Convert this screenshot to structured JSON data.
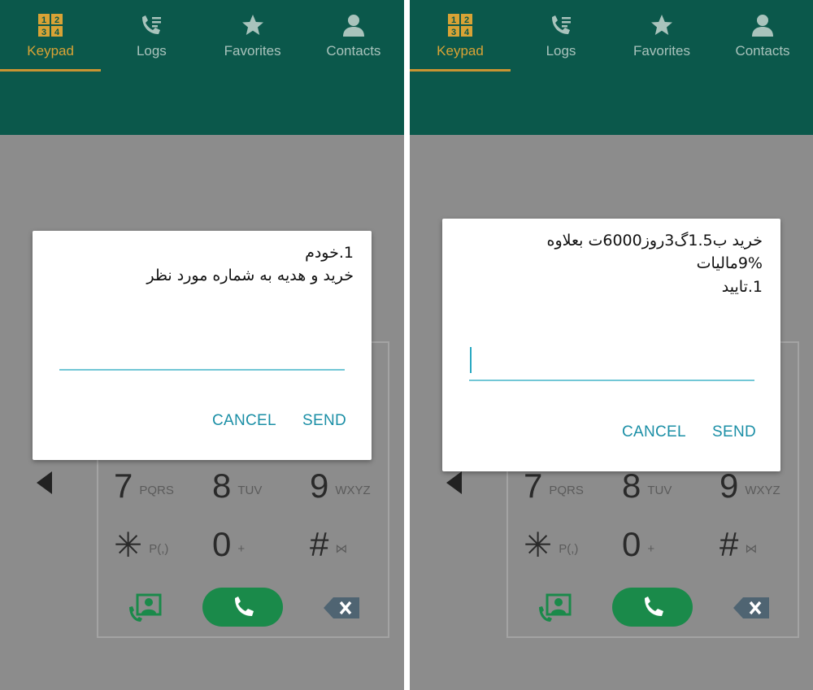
{
  "tabs": [
    {
      "label": "Keypad",
      "icon": "keypad-icon"
    },
    {
      "label": "Logs",
      "icon": "call-logs-icon"
    },
    {
      "label": "Favorites",
      "icon": "star-icon"
    },
    {
      "label": "Contacts",
      "icon": "person-icon"
    }
  ],
  "keypad_icon_digits": [
    "1",
    "2",
    "3",
    "4"
  ],
  "keys": [
    {
      "num": "7",
      "sub": "PQRS"
    },
    {
      "num": "8",
      "sub": "TUV"
    },
    {
      "num": "9",
      "sub": "WXYZ"
    },
    {
      "num": "✳",
      "sub": "P(,)"
    },
    {
      "num": "0",
      "sub": "+"
    },
    {
      "num": "#",
      "sub": "⋈"
    }
  ],
  "dialog_left": {
    "line1": "1.خودم",
    "line2": "خرید و هدیه به شماره مورد نظر",
    "input_value": "",
    "cancel_label": "CANCEL",
    "send_label": "SEND"
  },
  "dialog_right": {
    "line1": "خرید ب1.5گ3روز6000ت بعلاوه",
    "line2": "9%مالیات",
    "line3": "1.تایید",
    "input_value": "",
    "cancel_label": "CANCEL",
    "send_label": "SEND"
  },
  "colors": {
    "header": "#0b584b",
    "active_tab": "#d9a335",
    "inactive_tab": "#a9c3bc",
    "dim_overlay": "#8c8c8c",
    "call_button": "#1a8a4a",
    "dialog_button": "#1b8fa6",
    "input_underline": "#72c7d6"
  }
}
